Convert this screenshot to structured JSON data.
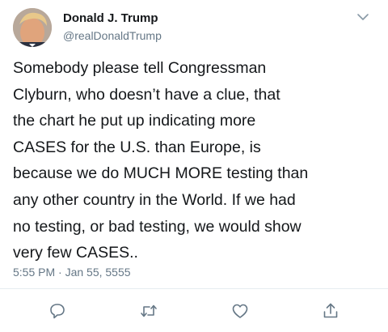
{
  "tweet": {
    "author": {
      "display_name": "Donald J. Trump",
      "handle": "@realDonaldTrump"
    },
    "text": "Somebody please tell Congressman\nClyburn, who doesn’t have a clue, that\nthe chart he put up indicating more\nCASES for the U.S. than Europe, is\nbecause we do MUCH MORE testing than\nany other country in the World. If we had\nno testing, or bad testing, we would show\nvery few CASES..",
    "timestamp": "5:55 PM · Jan 55, 5555"
  },
  "icons": {
    "menu": "chevron-down-icon",
    "reply": "reply-icon",
    "retweet": "retweet-icon",
    "like": "heart-icon",
    "share": "share-icon"
  },
  "colors": {
    "text": "#14171a",
    "secondary": "#657786",
    "icon": "#657786",
    "divider": "#e6ecf0"
  }
}
